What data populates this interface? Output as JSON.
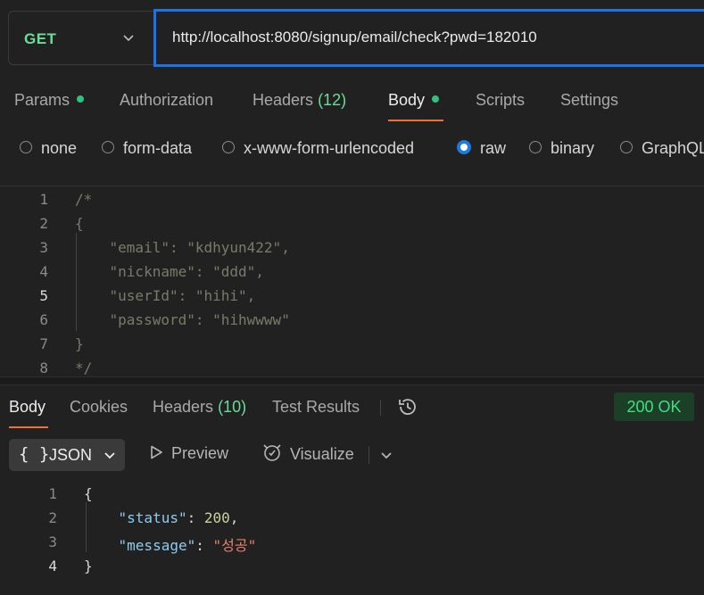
{
  "request": {
    "method": "GET",
    "url": "http://localhost:8080/signup/email/check?pwd=182010"
  },
  "request_tabs": [
    {
      "label": "Params",
      "dot": true
    },
    {
      "label": "Authorization"
    },
    {
      "label": "Headers",
      "count": "(12)"
    },
    {
      "label": "Body",
      "dot": true,
      "active": true
    },
    {
      "label": "Scripts"
    },
    {
      "label": "Settings"
    }
  ],
  "body_types": [
    {
      "label": "none"
    },
    {
      "label": "form-data"
    },
    {
      "label": "x-www-form-urlencoded"
    },
    {
      "label": "raw",
      "selected": true
    },
    {
      "label": "binary"
    },
    {
      "label": "GraphQL"
    }
  ],
  "request_body": {
    "lines": [
      {
        "num": "1",
        "text": "/*"
      },
      {
        "num": "2",
        "text": "{"
      },
      {
        "num": "3",
        "text": "    \"email\": \"kdhyun422\","
      },
      {
        "num": "4",
        "text": "    \"nickname\": \"ddd\","
      },
      {
        "num": "5",
        "text": "    \"userId\": \"hihi\","
      },
      {
        "num": "6",
        "text": "    \"password\": \"hihwwww\""
      },
      {
        "num": "7",
        "text": "}"
      },
      {
        "num": "8",
        "text": "*/"
      }
    ]
  },
  "response_tabs": [
    {
      "label": "Body",
      "active": true
    },
    {
      "label": "Cookies"
    },
    {
      "label": "Headers",
      "count": "(10)"
    },
    {
      "label": "Test Results"
    }
  ],
  "response_status": "200 OK",
  "response_toolbar": {
    "format": "JSON",
    "preview": "Preview",
    "visualize": "Visualize"
  },
  "response_body": {
    "line_numbers": [
      "1",
      "2",
      "3",
      "4"
    ],
    "open_brace": "{",
    "close_brace": "}",
    "status_key": "\"status\"",
    "status_value": "200",
    "message_key": "\"message\"",
    "message_value": "\"성공\""
  },
  "colors": {
    "accent_underline": "#f06f3f",
    "method": "#6bdd9a",
    "url_focus": "#1a73e8",
    "status_ok": "#3ee07f",
    "json_key": "#8ecbf0",
    "json_number": "#c9d39a",
    "json_string": "#e8806a"
  },
  "icons": [
    "chevron-down-icon",
    "history-icon",
    "curly-braces-icon",
    "play-icon",
    "visualize-icon"
  ]
}
